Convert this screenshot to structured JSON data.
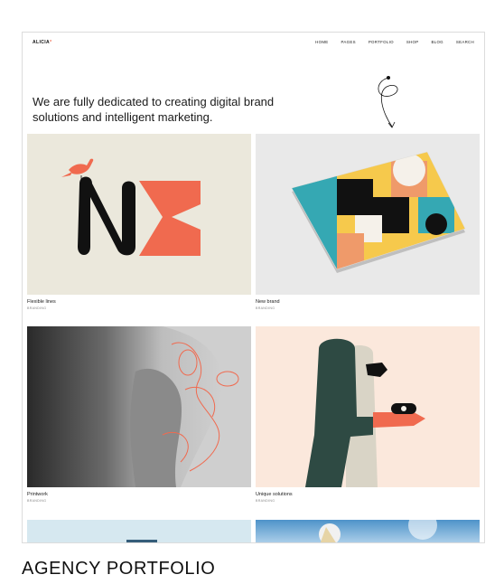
{
  "site": {
    "logo": "ALICIA",
    "logo_dot": "*",
    "nav": [
      "HOME",
      "PAGES",
      "PORTFOLIO",
      "SHOP",
      "BLOG",
      "SEARCH"
    ]
  },
  "hero": {
    "headline": "We are fully dedicated to creating digital brand solutions and intelligent marketing."
  },
  "projects": [
    {
      "title": "Flexible lines",
      "category": "BRANDING"
    },
    {
      "title": "New brand",
      "category": "BRANDING"
    },
    {
      "title": "Printwork",
      "category": "BRANDING"
    },
    {
      "title": "Unique solutions",
      "category": "BRANDING"
    }
  ],
  "caption": "AGENCY PORTFOLIO",
  "colors": {
    "accent": "#f06a4f",
    "cream": "#ebe8dc",
    "peach": "#fbe8dc",
    "sky": "#d6e8f0",
    "dark_green": "#2e4a43"
  }
}
